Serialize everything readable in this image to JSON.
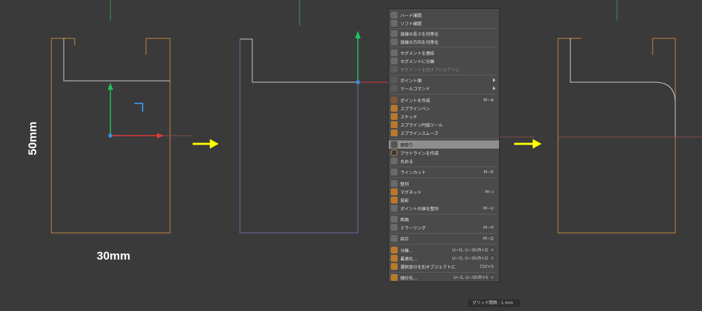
{
  "dimensions": {
    "height_label": "50mm",
    "width_label": "30mm"
  },
  "colors": {
    "background": "#3a3a3a",
    "orange_spline": "#c98a43",
    "selected_spline": "#cfcfcf",
    "y_axis": "#22c55e",
    "x_axis": "#e23b3b",
    "arrow": "#ffff00",
    "menu_bg": "#4a4a4a",
    "menu_highlight": "#8e8e8e"
  },
  "context_menu": {
    "items": [
      {
        "label": "ハード補間",
        "shortcut": "",
        "icon": "hard-interpolation-icon"
      },
      {
        "label": "ソフト補間",
        "shortcut": "",
        "icon": "soft-interpolation-icon"
      },
      {
        "label": "接線の長さを均等化",
        "shortcut": "",
        "icon": "equal-tangent-length-icon"
      },
      {
        "label": "接線の方向を均等化",
        "shortcut": "",
        "icon": "equal-tangent-direction-icon"
      },
      {
        "label": "セグメントを連結",
        "shortcut": "",
        "icon": "join-segment-icon"
      },
      {
        "label": "セグメントに分離",
        "shortcut": "",
        "icon": "break-segment-icon"
      },
      {
        "label": "セグメントを別オブジェクトに",
        "shortcut": "",
        "icon": "explode-segments-icon",
        "disabled": true
      },
      {
        "label": "ポイント順",
        "shortcut": "",
        "icon": "point-order-icon",
        "submenu": true
      },
      {
        "label": "ツールコマンド",
        "shortcut": "",
        "icon": "tool-commands-icon",
        "submenu": true
      },
      {
        "label": "ポイントを作成",
        "shortcut": "M~A",
        "icon": "create-point-icon"
      },
      {
        "label": "スプラインペン",
        "shortcut": "",
        "icon": "spline-pen-icon"
      },
      {
        "label": "スケッチ",
        "shortcut": "",
        "icon": "sketch-icon"
      },
      {
        "label": "スプライン円弧ツール",
        "shortcut": "",
        "icon": "spline-arc-icon"
      },
      {
        "label": "スプラインスムーズ",
        "shortcut": "",
        "icon": "spline-smooth-icon"
      },
      {
        "label": "面取り",
        "shortcut": "",
        "icon": "chamfer-icon",
        "highlighted": true
      },
      {
        "label": "アウトラインを作成",
        "shortcut": "",
        "icon": "create-outline-icon"
      },
      {
        "label": "丸める",
        "shortcut": "",
        "icon": "round-icon"
      },
      {
        "label": "ラインカット",
        "shortcut": "M~K",
        "icon": "line-cut-icon"
      },
      {
        "label": "整列",
        "shortcut": "",
        "icon": "align-icon"
      },
      {
        "label": "マグネット",
        "shortcut": "M~I",
        "icon": "magnet-icon"
      },
      {
        "label": "投影",
        "shortcut": "",
        "icon": "project-icon"
      },
      {
        "label": "ポイントの値を整列",
        "shortcut": "M~U",
        "icon": "set-point-value-icon"
      },
      {
        "label": "断面",
        "shortcut": "",
        "icon": "cross-section-icon"
      },
      {
        "label": "ミラーリング",
        "shortcut": "M~H",
        "icon": "mirror-icon"
      },
      {
        "label": "結合",
        "shortcut": "M~Q",
        "icon": "weld-icon"
      },
      {
        "label": "分離...",
        "shortcut": "U~D, U~Shift+D",
        "icon": "split-icon",
        "gear": true
      },
      {
        "label": "最適化...",
        "shortcut": "U~O, U~Shift+O",
        "icon": "optimize-icon",
        "gear": true
      },
      {
        "label": "選択部分を別オブジェクトに",
        "shortcut": "Ctrl+S",
        "icon": "split-selection-icon"
      },
      {
        "label": "細分化...",
        "shortcut": "U~S, U~Shift+S",
        "icon": "subdivide-icon",
        "gear": true
      }
    ]
  },
  "status_bar": {
    "grid_spacing": "グリッド間隔 : 1 mm"
  }
}
